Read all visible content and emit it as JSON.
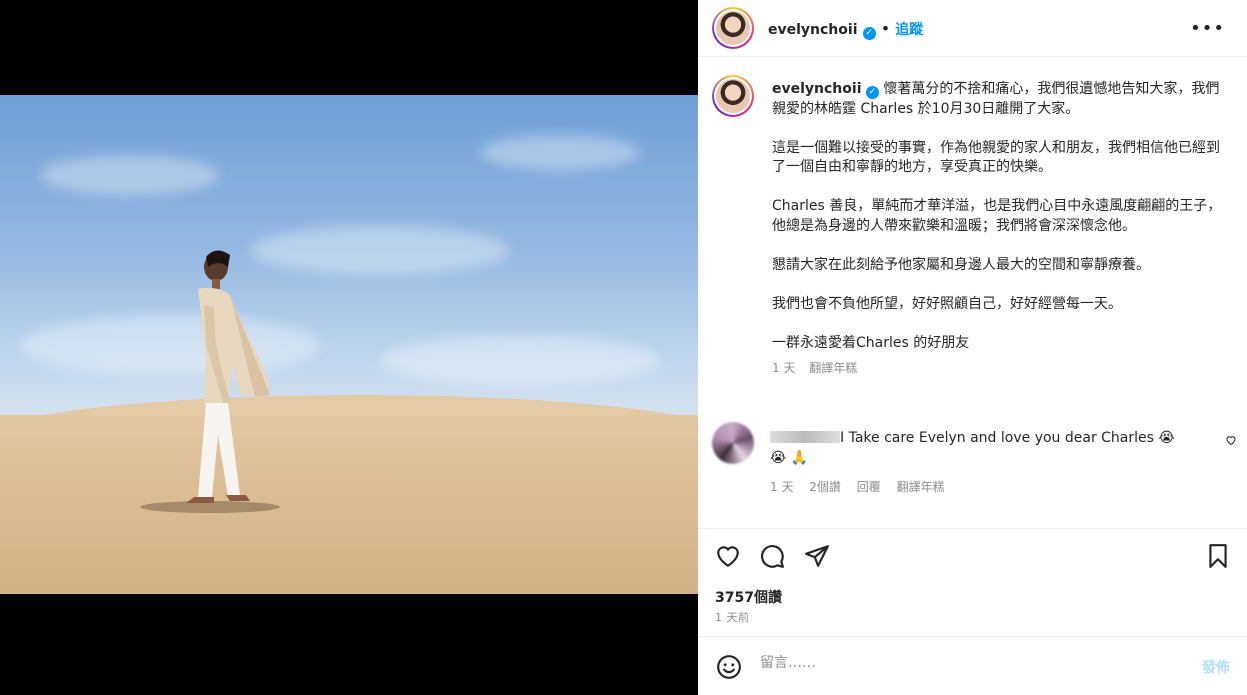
{
  "post": {
    "username": "evelynchoii",
    "verified_icon": "verified-badge-icon",
    "separator": "•",
    "follow_label": "追蹤",
    "more_icon": "more-options-icon",
    "caption": [
      "懷著萬分的不捨和痛心，我們很遺憾地告知大家，我們親愛的林皓霆 Charles 於10月30日離開了大家。",
      "這是一個難以接受的事實，作為他親愛的家人和朋友，我們相信他已經到了一個自由和寧靜的地方，享受真正的快樂。",
      "Charles 善良，單純而才華洋溢，也是我們心目中永遠風度翩翩的王子，他總是為身邊的人帶來歡樂和溫暖；我們將會深深懷念他。",
      "懇請大家在此刻給予他家屬和身邊人最大的空間和寧靜療養。",
      "我們也會不負他所望，好好照顧自己，好好經營每一天。",
      "一群永遠愛着Charles 的好朋友"
    ],
    "caption_meta": {
      "age": "1 天",
      "translate": "翻譯年糕"
    }
  },
  "comment": {
    "text": "I Take care Evelyn and love you dear Charles 😭😭 🙏",
    "meta": {
      "age": "1 天",
      "likes": "2個讚",
      "reply": "回覆",
      "translate": "翻譯年糕"
    },
    "heart_icon": "heart-outline-icon"
  },
  "actions": {
    "icons": [
      "heart-icon",
      "comment-icon",
      "share-icon",
      "bookmark-icon"
    ],
    "likes": "3757個讚",
    "time": "1 天前"
  },
  "composer": {
    "placeholder": "留言……",
    "post_label": "發佈",
    "emoji_icon": "emoji-icon"
  },
  "colors": {
    "accent": "#0095f6",
    "post_disabled": "#b2dffc",
    "muted": "#8e8e8e"
  }
}
